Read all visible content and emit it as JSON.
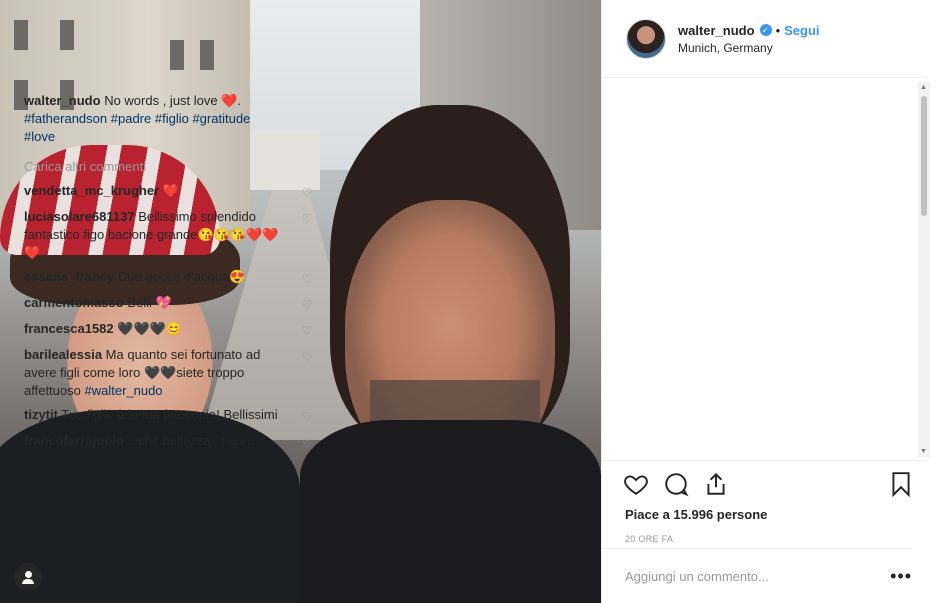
{
  "post": {
    "username": "walter_nudo",
    "verified_badge": "✓",
    "dot": "•",
    "follow_label": "Segui",
    "location": "Munich, Germany"
  },
  "caption": {
    "username": "walter_nudo",
    "text": " No words , just love ",
    "emoji": "❤️",
    "after_emoji": ".",
    "hashtags": [
      "#fatherandson",
      "#padre",
      "#figlio",
      "#gratitude",
      "#love"
    ]
  },
  "load_more_label": "Carica altri commenti",
  "comments": [
    {
      "user": "vendetta_mc_krugher",
      "text": " ❤️"
    },
    {
      "user": "luciasolare681137",
      "text": " Bellissimo splendido fantastico figo bacione grande😘😘😘❤️❤️❤️"
    },
    {
      "user": "essens_francy",
      "text": " Due gocce d’acqua😍"
    },
    {
      "user": "carmentomasso",
      "text": " Belli 💖"
    },
    {
      "user": "francesca1582",
      "text": " 🖤🖤🖤😊"
    },
    {
      "user": "barilealessia",
      "text": " Ma quanto sei fortunato ad avere figli come loro 🖤🖤siete troppo affettuoso ",
      "tag": "#walter_nudo"
    },
    {
      "user": "tizytit",
      "text": " Tuo figlio è la tua fotocopia! Bellissimi"
    },
    {
      "user": "francoferrajuolo",
      "text": " ...che bellezza...padre"
    }
  ],
  "icons": {
    "comment_like": "heart-outline-icon",
    "like": "heart-icon",
    "comment": "comment-bubble-icon",
    "share": "share-icon",
    "save": "bookmark-icon",
    "tag_user": "user-tag-icon",
    "more": "more-options-icon"
  },
  "comment_heart_glyph": "♡",
  "likes_text": "Piace a 15.996 persone",
  "time_text": "20 ORE FA",
  "add_comment_placeholder": "Aggiungi un commento...",
  "more_options": "•••",
  "scroll_up": "▲",
  "scroll_down": "▼"
}
